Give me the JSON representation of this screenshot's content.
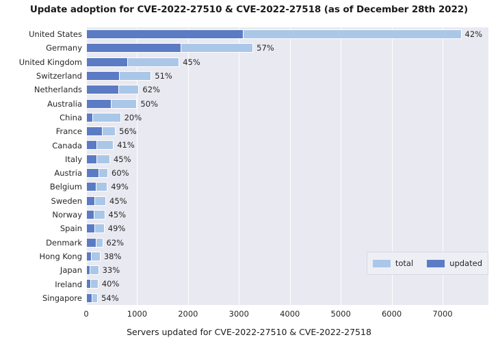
{
  "chart_data": {
    "type": "bar",
    "orientation": "horizontal",
    "barmode": "overlay",
    "title": "Update adoption for CVE-2022-27510 & CVE-2022-27518 (as of December 28th 2022)",
    "xlabel": "Servers updated for CVE-2022-27510 & CVE-2022-27518",
    "ylabel": "",
    "xlim": [
      0,
      7900
    ],
    "xticks": [
      0,
      1000,
      2000,
      3000,
      4000,
      5000,
      6000,
      7000
    ],
    "xtick_labels": [
      "0",
      "1000",
      "2000",
      "3000",
      "4000",
      "5000",
      "6000",
      "7000"
    ],
    "grid": true,
    "grid_axis": "x",
    "legend_position": "lower right",
    "colors": {
      "total": "#aac7e8",
      "updated": "#5b7cc4",
      "plot_background": "#e9e9f1",
      "gridline": "#ffffff",
      "figure_background": "#ffffff",
      "text": "#262626"
    },
    "categories": [
      "United States",
      "Germany",
      "United Kingdom",
      "Switzerland",
      "Netherlands",
      "Australia",
      "China",
      "France",
      "Canada",
      "Italy",
      "Austria",
      "Belgium",
      "Sweden",
      "Norway",
      "Spain",
      "Denmark",
      "Hong Kong",
      "Japan",
      "Ireland",
      "Singapore"
    ],
    "series": [
      {
        "name": "total",
        "values": [
          7370,
          3280,
          1830,
          1280,
          1040,
          1000,
          680,
          580,
          540,
          470,
          430,
          420,
          390,
          370,
          360,
          330,
          280,
          250,
          240,
          230
        ]
      },
      {
        "name": "updated",
        "values": [
          3095,
          1870,
          825,
          655,
          645,
          500,
          135,
          325,
          220,
          210,
          260,
          205,
          175,
          165,
          175,
          205,
          105,
          80,
          95,
          125
        ]
      }
    ],
    "data_labels": [
      "42%",
      "57%",
      "45%",
      "51%",
      "62%",
      "50%",
      "20%",
      "56%",
      "41%",
      "45%",
      "60%",
      "49%",
      "45%",
      "45%",
      "49%",
      "62%",
      "38%",
      "33%",
      "40%",
      "54%"
    ],
    "legend_entries": [
      {
        "label": "total",
        "color": "#aac7e8"
      },
      {
        "label": "updated",
        "color": "#5b7cc4"
      }
    ]
  }
}
